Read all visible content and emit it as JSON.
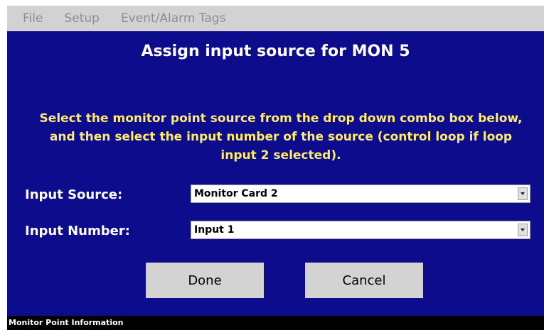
{
  "menu": {
    "items": [
      "File",
      "Setup",
      "Event/Alarm Tags"
    ]
  },
  "dialog": {
    "title": "Assign input source for MON 5",
    "instructions": "Select the monitor point source from the drop down combo box below, and then select the input number of the source (control loop if loop input 2 selected).",
    "input_source": {
      "label": "Input Source:",
      "value": "Monitor Card 2"
    },
    "input_number": {
      "label": "Input Number:",
      "value": "Input 1"
    },
    "done_label": "Done",
    "cancel_label": "Cancel"
  },
  "status": {
    "text": "Monitor Point Information"
  },
  "colors": {
    "panel_bg": "#0c0c8c",
    "instruction_text": "#ffeb6e",
    "menubar_bg": "#d2d2d2",
    "button_bg": "#d3d3d3"
  }
}
